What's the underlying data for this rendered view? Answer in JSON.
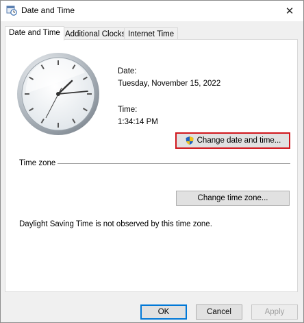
{
  "window": {
    "title": "Date and Time"
  },
  "tabs": [
    {
      "label": "Date and Time"
    },
    {
      "label": "Additional Clocks"
    },
    {
      "label": "Internet Time"
    }
  ],
  "date": {
    "label": "Date:",
    "value": "Tuesday, November 15, 2022"
  },
  "time": {
    "label": "Time:",
    "value": "1:34:14 PM"
  },
  "buttons": {
    "change_datetime": "Change date and time...",
    "change_timezone": "Change time zone...",
    "ok": "OK",
    "cancel": "Cancel",
    "apply": "Apply"
  },
  "timezone": {
    "heading": "Time zone",
    "dst_note": "Daylight Saving Time is not observed by this time zone."
  },
  "icons": {
    "title": "calendar-clock-icon",
    "close": "close-icon",
    "shield": "uac-shield-icon"
  },
  "colors": {
    "highlight_border": "#d0161c",
    "primary_border": "#0078d7"
  }
}
